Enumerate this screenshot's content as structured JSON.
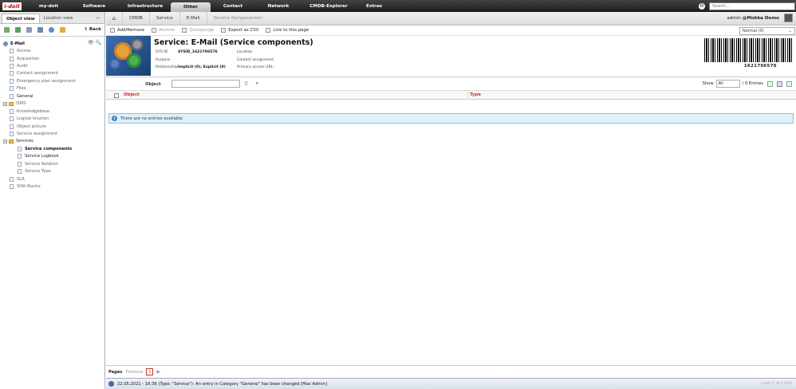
{
  "brand": {
    "logo": "i-doit"
  },
  "topnav": {
    "items": [
      {
        "label": "my-doit",
        "w": 50
      },
      {
        "label": "Software",
        "w": 64
      },
      {
        "label": "Infrastructure",
        "w": 64
      },
      {
        "label": "Other",
        "w": 50
      },
      {
        "label": "Contact",
        "w": 56
      },
      {
        "label": "Network",
        "w": 58
      },
      {
        "label": "CMDB-Explorer",
        "w": 68
      },
      {
        "label": "Extras",
        "w": 46
      }
    ],
    "active": "Other",
    "search_placeholder": "Search..."
  },
  "sidebar": {
    "tabs": {
      "object_view": "Object view",
      "location_view": "Location view"
    },
    "back_label": "Back",
    "root": "E-Mail",
    "items": [
      {
        "label": "Access",
        "type": "leaf"
      },
      {
        "label": "Acquisition",
        "type": "leaf"
      },
      {
        "label": "Audit",
        "type": "leaf"
      },
      {
        "label": "Contact assignment",
        "type": "leaf"
      },
      {
        "label": "Emergency plan assignment",
        "type": "leaf"
      },
      {
        "label": "Files",
        "type": "leaf"
      },
      {
        "label": "General",
        "type": "leaf-dark"
      },
      {
        "label": "ISMS",
        "type": "folder"
      },
      {
        "label": "Knowledgebase",
        "type": "leaf"
      },
      {
        "label": "Logical location",
        "type": "leaf"
      },
      {
        "label": "Object picture",
        "type": "leaf"
      },
      {
        "label": "Service assignment",
        "type": "leaf"
      },
      {
        "label": "Services",
        "type": "folder-open"
      },
      {
        "label": "Service components",
        "type": "child-bold"
      },
      {
        "label": "Service Logbook",
        "type": "child-dark"
      },
      {
        "label": "Service Relation",
        "type": "child"
      },
      {
        "label": "Service Type",
        "type": "child"
      },
      {
        "label": "SLA",
        "type": "leaf"
      },
      {
        "label": "SOA-Stacks",
        "type": "leaf"
      }
    ]
  },
  "breadcrumb": [
    "CMDB",
    "Service",
    "E-Mail",
    "Service Komponenten"
  ],
  "user": {
    "name": "admin",
    "tenant": "@Mokka Demo"
  },
  "actions": [
    {
      "label": "Add/Remove",
      "enabled": true
    },
    {
      "label": "Archive",
      "enabled": false
    },
    {
      "label": "Quickpurge",
      "enabled": false
    },
    {
      "label": "Export as CSV",
      "enabled": true
    },
    {
      "label": "Link to this page",
      "enabled": true
    }
  ],
  "view_select": "Normal (0)",
  "object": {
    "title": "Service: E-Mail (Service components)",
    "sysid_label": "SYS-ID",
    "sysid": "SYSID_1621706576",
    "purpose_label": "Purpose",
    "purpose": "",
    "relationship_label": "Relationship",
    "relationship": "Implicit (0), Explicit (0)",
    "location_label": "Location",
    "location": "",
    "contact_label": "Contact assignment",
    "contact": "",
    "url_label": "Primary access URL",
    "url": "-",
    "barcode": "1621706576"
  },
  "filter": {
    "label": "Object"
  },
  "show": {
    "label": "Show",
    "value": "All",
    "entries": "/ 0 Entries"
  },
  "table": {
    "columns": [
      "Object",
      "Type"
    ],
    "empty_message": "There are no entries available"
  },
  "pager": {
    "label": "Pages",
    "previous": "Previous",
    "current": "1"
  },
  "status": {
    "message": "22.05.2021 - 16:36 (Type: \"Service\"): An entry in Category \"General\" has been changed [Max Admin]",
    "version": "i-doit 1.16.2 PRO"
  },
  "colors": {
    "accent": "#c0392b",
    "info": "#dff0f8"
  }
}
